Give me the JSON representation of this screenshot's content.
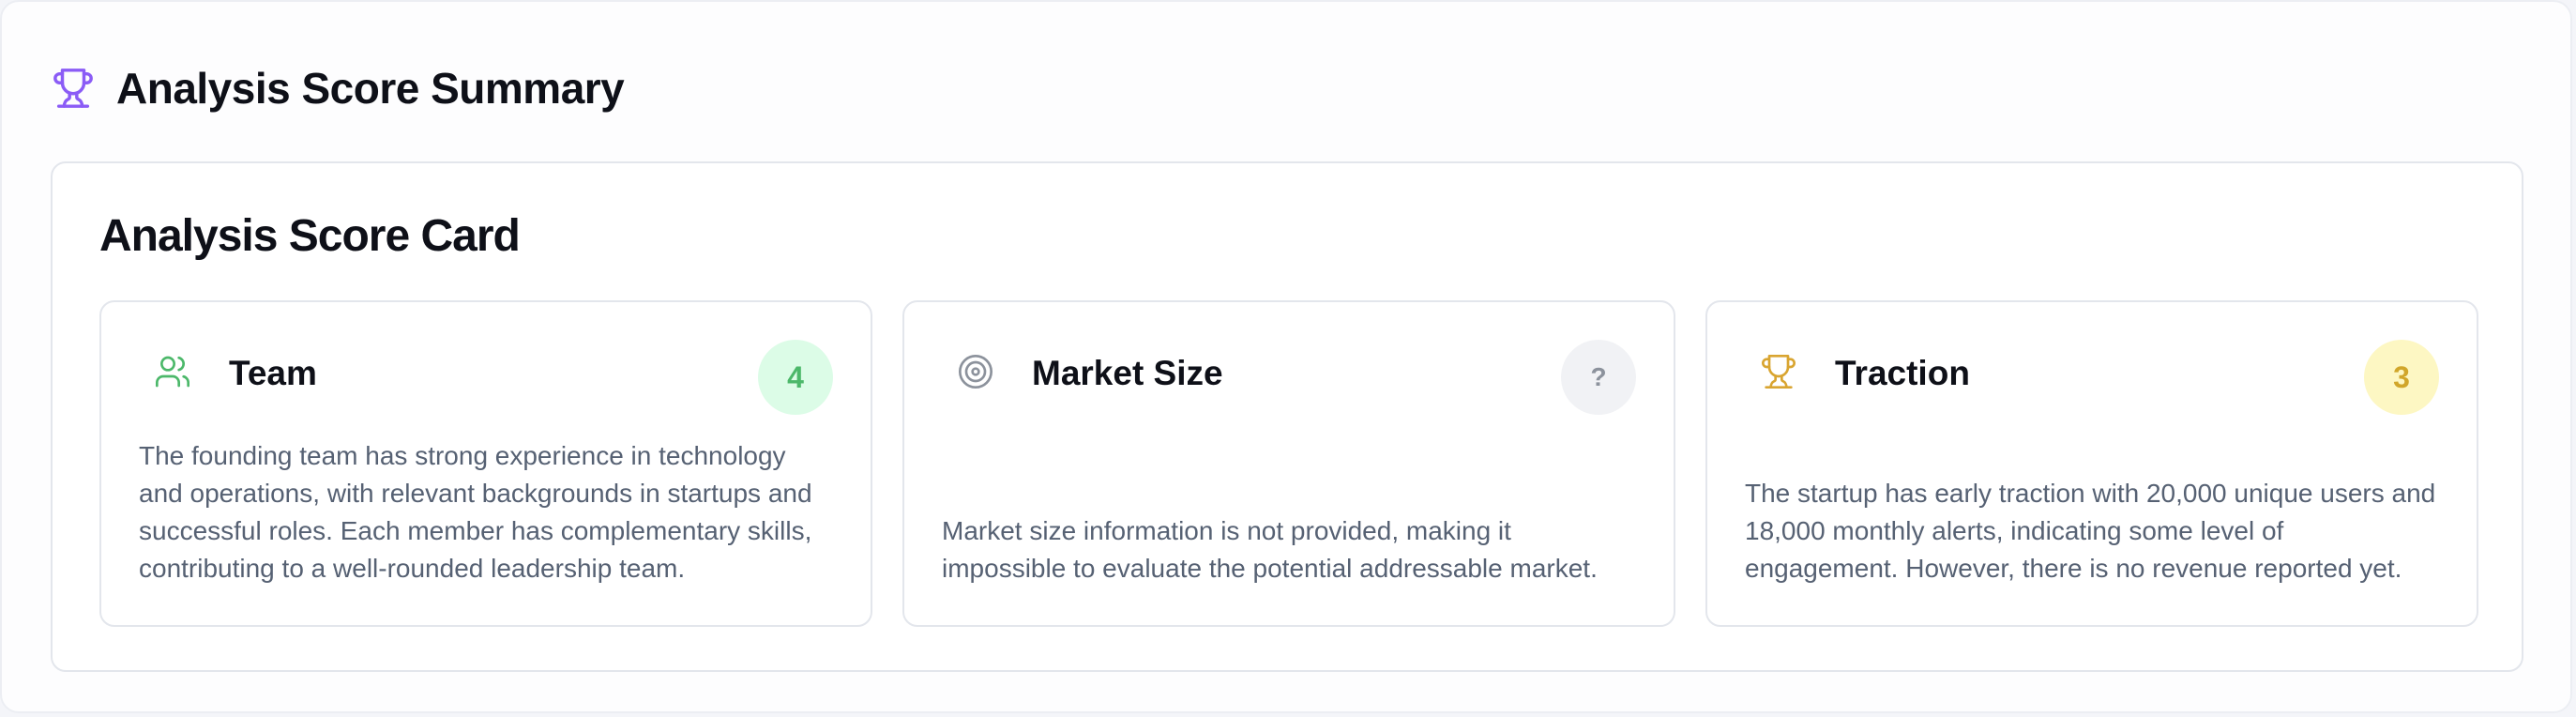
{
  "header": {
    "title": "Analysis Score Summary",
    "icon": "trophy-icon"
  },
  "card": {
    "title": "Analysis Score Card"
  },
  "categories": [
    {
      "title": "Team",
      "icon": "users-icon",
      "score": "4",
      "badge_color": "#dcfce7",
      "badge_text_color": "#4cb86a",
      "description": "The founding team has strong experience in technology and operations, with relevant backgrounds in startups and successful roles. Each member has complementary skills, contributing to a well-rounded leadership team."
    },
    {
      "title": "Market Size",
      "icon": "target-icon",
      "score": "?",
      "badge_color": "#f1f2f5",
      "badge_text_color": "#8c929c",
      "description": "Market size information is not provided, making it impossible to evaluate the potential addressable market."
    },
    {
      "title": "Traction",
      "icon": "trophy-icon",
      "score": "3",
      "badge_color": "#fdf7c3",
      "badge_text_color": "#d1a62a",
      "description": "The startup has early traction with 20,000 unique users and 18,000 monthly alerts, indicating some level of engagement. However, there is no revenue reported yet."
    }
  ],
  "colors": {
    "accent_purple": "#8b5cf6",
    "team_green": "#4cb86a",
    "market_gray": "#8c929c",
    "traction_gold": "#d9a531"
  }
}
